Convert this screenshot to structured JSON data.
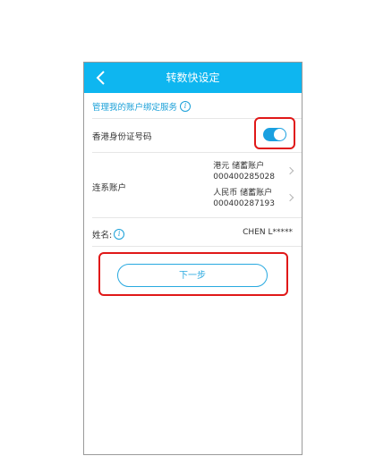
{
  "header": {
    "title": "转数快设定"
  },
  "section": {
    "link_label": "管理我的账户绑定服务",
    "info_glyph": "i"
  },
  "hkid_row": {
    "label": "香港身份证号码",
    "toggle_on": true
  },
  "linked_accounts": {
    "label": "连系账户",
    "accounts": [
      {
        "type": "港元 储蓄账户",
        "number": "000400285028"
      },
      {
        "type": "人民币 储蓄账户",
        "number": "000400287193"
      }
    ]
  },
  "name_row": {
    "label": "姓名:",
    "value": "CHEN L*****",
    "info_glyph": "i"
  },
  "actions": {
    "next_label": "下一步"
  },
  "colors": {
    "accent": "#0eb6f0",
    "highlight": "#e01818",
    "button_text": "#28a9e0"
  }
}
